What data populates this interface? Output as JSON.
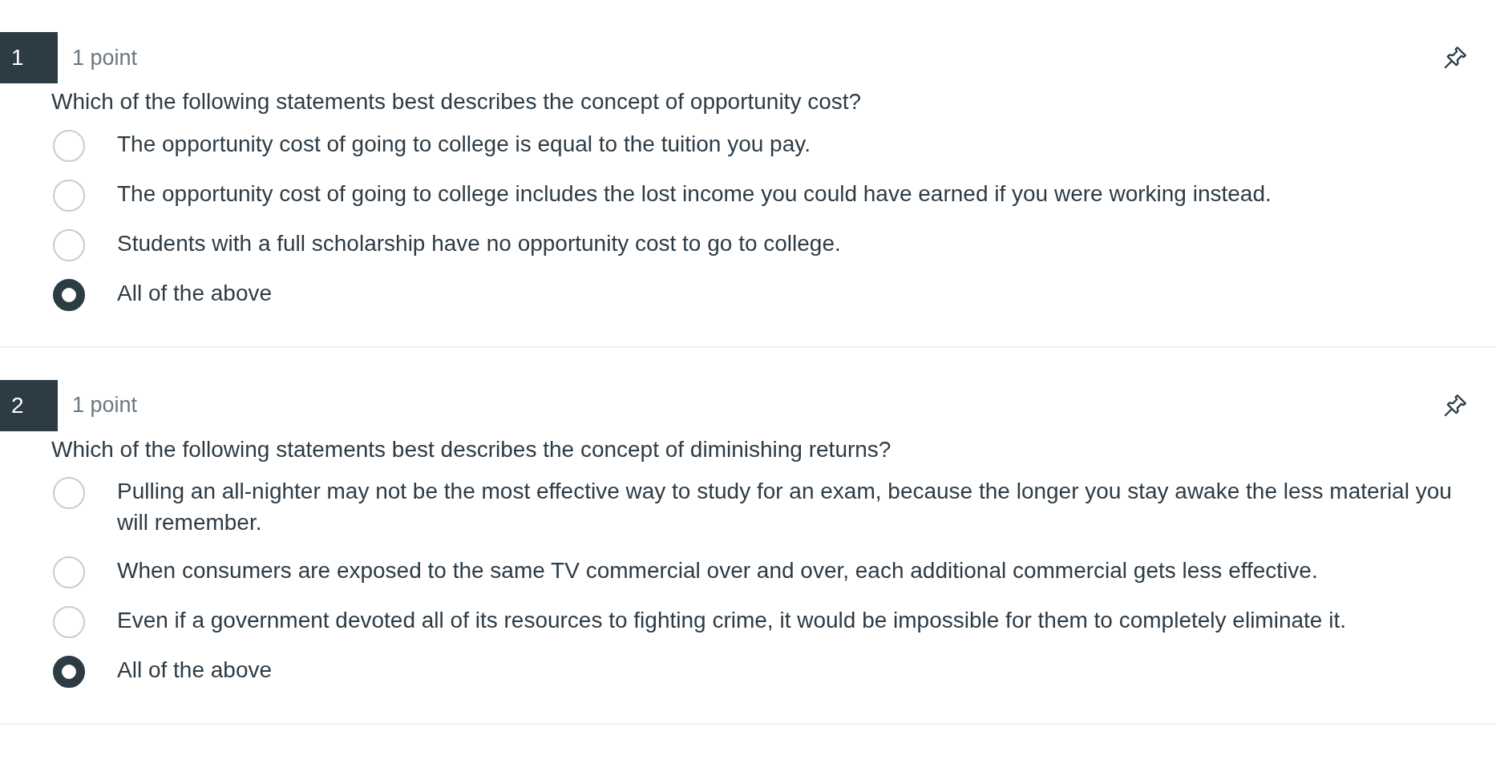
{
  "questions": [
    {
      "number": "1",
      "points": "1 point",
      "prompt": "Which of the following statements best describes the concept of opportunity cost?",
      "options": [
        {
          "label": "The opportunity cost of going to college is equal to the tuition you pay.",
          "selected": false
        },
        {
          "label": "The opportunity cost of going to college includes the lost income you could have earned if you were working instead.",
          "selected": false
        },
        {
          "label": "Students with a full scholarship have no opportunity cost to go to college.",
          "selected": false
        },
        {
          "label": "All of the above",
          "selected": true
        }
      ]
    },
    {
      "number": "2",
      "points": "1 point",
      "prompt": "Which of the following statements best describes the concept of diminishing returns?",
      "options": [
        {
          "label": "Pulling an all-nighter may not be the most effective way to study for an exam, because the longer you stay awake the less material you will remember.",
          "selected": false
        },
        {
          "label": "When consumers are exposed to the same TV commercial over and over, each additional commercial gets less effective.",
          "selected": false
        },
        {
          "label": "Even if a government devoted all of its resources to fighting crime, it would be impossible for them to completely eliminate it.",
          "selected": false
        },
        {
          "label": "All of the above",
          "selected": true
        }
      ]
    }
  ]
}
